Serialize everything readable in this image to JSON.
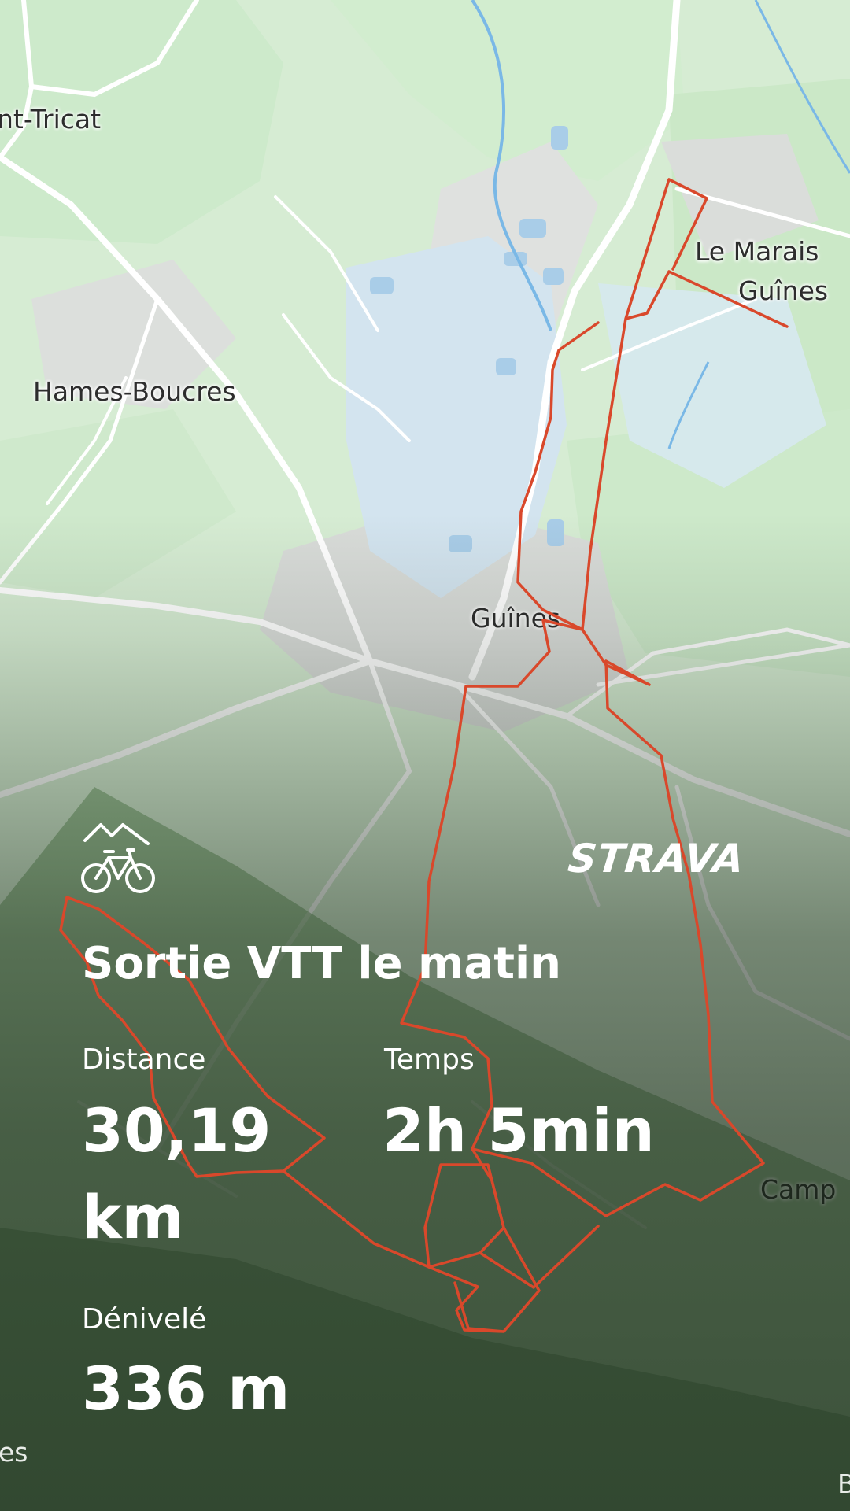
{
  "map": {
    "places": {
      "saint_tricat": "nt-Tricat",
      "hames_boucres": "Hames-Boucres",
      "le_marais_line1": "Le Marais",
      "le_marais_line2": "Guînes",
      "guines": "Guînes",
      "campagne": "Camp",
      "bottom_left": "es",
      "bottom_right": "B"
    },
    "route_color": "#d9482b"
  },
  "brand": {
    "logo_text": "STRAVA"
  },
  "activity": {
    "sport_icon": "mountain-bike-icon",
    "title": "Sortie VTT le matin",
    "stats": {
      "distance_label": "Distance",
      "distance_value": "30,19 km",
      "time_label": "Temps",
      "time_value": "2h 5min",
      "elevation_label": "Dénivelé",
      "elevation_value": "336 m"
    }
  }
}
